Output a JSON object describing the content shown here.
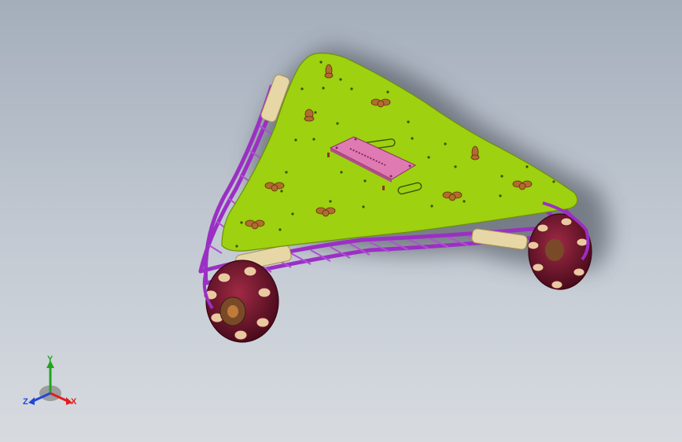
{
  "viewport": {
    "background_top": "#a4aebb",
    "background_bottom": "#d7dbe0"
  },
  "model": {
    "plate_color": "#9ed10f",
    "frame_color": "#9b2fc4",
    "pcb_color": "#e07ab3",
    "wheel_color": "#6e1429",
    "roller_color": "#e9c9a1",
    "nut_color": "#b36b2e"
  },
  "triad": {
    "x_label": "X",
    "y_label": "Y",
    "z_label": "Z",
    "x_color": "#e21d1d",
    "y_color": "#1fa51f",
    "z_color": "#2346d6"
  }
}
